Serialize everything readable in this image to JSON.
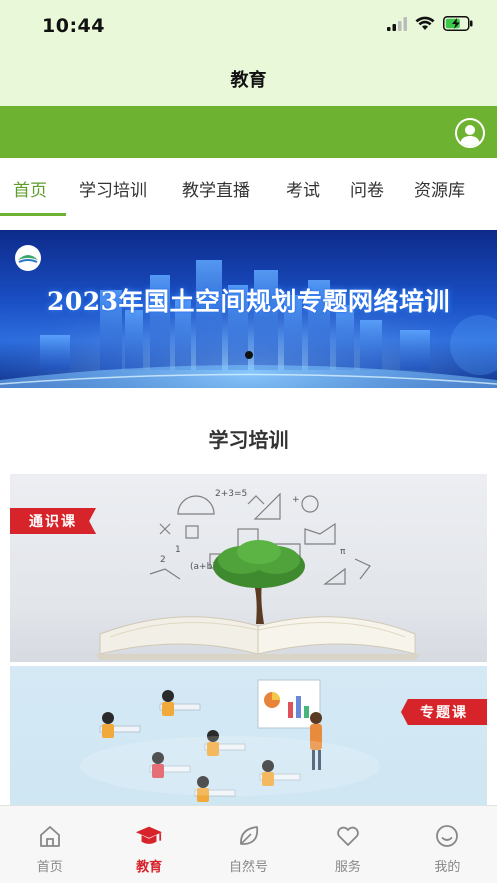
{
  "status_bar": {
    "time": "10:44"
  },
  "header": {
    "title": "教育"
  },
  "tabs": [
    {
      "label": "首页",
      "active": true
    },
    {
      "label": "学习培训"
    },
    {
      "label": "教学直播"
    },
    {
      "label": "考试"
    },
    {
      "label": "问卷"
    },
    {
      "label": "资源库"
    }
  ],
  "banner": {
    "text": "2023年国土空间规划专题网络培训"
  },
  "section": {
    "title": "学习培训"
  },
  "cards": [
    {
      "ribbon": "通识课"
    },
    {
      "ribbon": "专题课"
    }
  ],
  "bottom_nav": [
    {
      "label": "首页",
      "icon": "home-icon"
    },
    {
      "label": "教育",
      "icon": "graduation-cap-icon",
      "active": true
    },
    {
      "label": "自然号",
      "icon": "leaf-icon"
    },
    {
      "label": "服务",
      "icon": "heart-icon"
    },
    {
      "label": "我的",
      "icon": "smiley-icon"
    }
  ],
  "colors": {
    "header_bg": "#e9f8d8",
    "brand_green": "#6db231",
    "active_tab": "#5b9c2b",
    "accent_red": "#d7232a"
  }
}
